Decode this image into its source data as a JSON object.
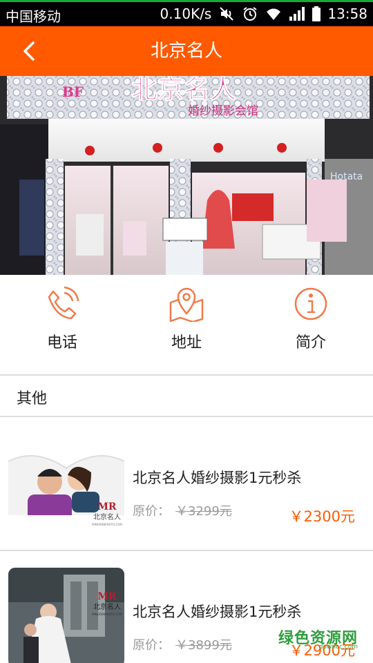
{
  "status_bar": {
    "carrier": "中国移动",
    "speed": "0.10K/s",
    "time": "13:58",
    "icons": [
      "mute-icon",
      "alarm-icon",
      "wifi-icon",
      "signal-icon",
      "battery-icon"
    ]
  },
  "header": {
    "title": "北京名人",
    "back_icon": "chevron-left-icon",
    "color": "#ff5a00"
  },
  "hero": {
    "sign_title": "北京名人",
    "sign_subtitle": "婚纱摄影会馆",
    "sign_logo": "BF",
    "side_sign": "Hotata"
  },
  "actions": [
    {
      "label": "电话",
      "icon": "phone-icon"
    },
    {
      "label": "地址",
      "icon": "map-pin-icon"
    },
    {
      "label": "简介",
      "icon": "info-icon"
    }
  ],
  "section": {
    "title": "其他"
  },
  "products": [
    {
      "name": "北京名人婚纱摄影1元秒杀",
      "orig_label": "原价：",
      "orig_price": "￥3299元",
      "price": "￥2300元",
      "thumb_brand": "北京名人",
      "thumb_logo": "MR",
      "thumb_url": "MINGRENPHOTO.COM"
    },
    {
      "name": "北京名人婚纱摄影1元秒杀",
      "orig_label": "原价：",
      "orig_price": "￥3899元",
      "price": "￥2900元",
      "thumb_brand": "北京名人",
      "thumb_logo": "MR",
      "thumb_url": "MINGRENPHOTO.COM"
    }
  ],
  "watermark": {
    "text": "绿色资源网",
    "url": "downcc.com"
  },
  "colors": {
    "accent": "#ff5a00",
    "icon_stroke": "#f07a4a"
  }
}
